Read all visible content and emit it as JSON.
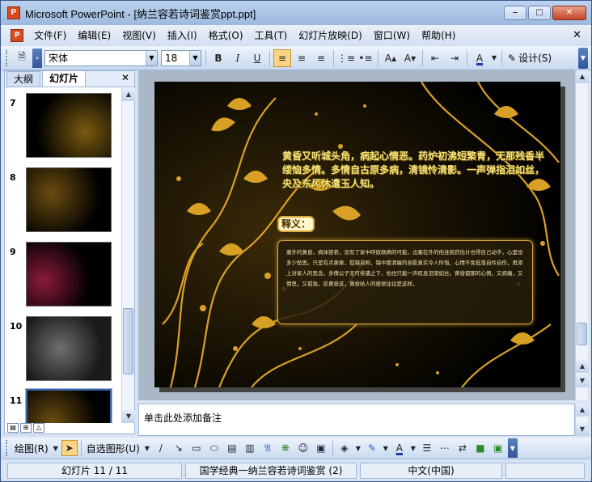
{
  "window": {
    "title": "Microsoft PowerPoint - [纳兰容若诗词鉴赏ppt.ppt]",
    "app_icon": "P"
  },
  "menu": [
    "文件(F)",
    "编辑(E)",
    "视图(V)",
    "插入(I)",
    "格式(O)",
    "工具(T)",
    "幻灯片放映(D)",
    "窗口(W)",
    "帮助(H)"
  ],
  "toolbar": {
    "font": "宋体",
    "size": "18",
    "bold": "B",
    "italic": "I",
    "underline": "U",
    "design_label": "设计(S)"
  },
  "pane": {
    "tab_outline": "大纲",
    "tab_slides": "幻灯片"
  },
  "thumbnails": [
    {
      "num": "7"
    },
    {
      "num": "8"
    },
    {
      "num": "9"
    },
    {
      "num": "10"
    },
    {
      "num": "11"
    }
  ],
  "slide": {
    "verse": "黄昏又听城头角，病起心情恶。药炉初沸短檠青，无那残香半缕恼多情。多情自古原多病，清镜怜清影。一声弹指泪如丝，央及东风休遣玉人知。",
    "note_tag": "释义：",
    "note_text": "塞外的黄昏，病体容若，没有了家中呼奴唤婢的可能，出塞在外的他连煎药估计也得自己动手，心里没多少愁思。只是有点萧索，搅镜自照，镜中那清瘦的身影真实令人怜惜，心情不免低落自怜自伤，再添上对家人的思念，多情公子无可排遣之下，怕也只能一声叹息泪落如丝。黄昏都那的心情，又病痛，又情思，又孤独，反黄昏这，黄昏给人的感觉往往是这样。"
  },
  "notes_placeholder": "单击此处添加备注",
  "drawbar": {
    "draw_label": "绘图(R)",
    "autoshape_label": "自选图形(U)"
  },
  "status": {
    "slide": "幻灯片 11 / 11",
    "design": "国学经典一纳兰容若诗词鉴赏 (2)",
    "lang": "中文(中国)"
  }
}
